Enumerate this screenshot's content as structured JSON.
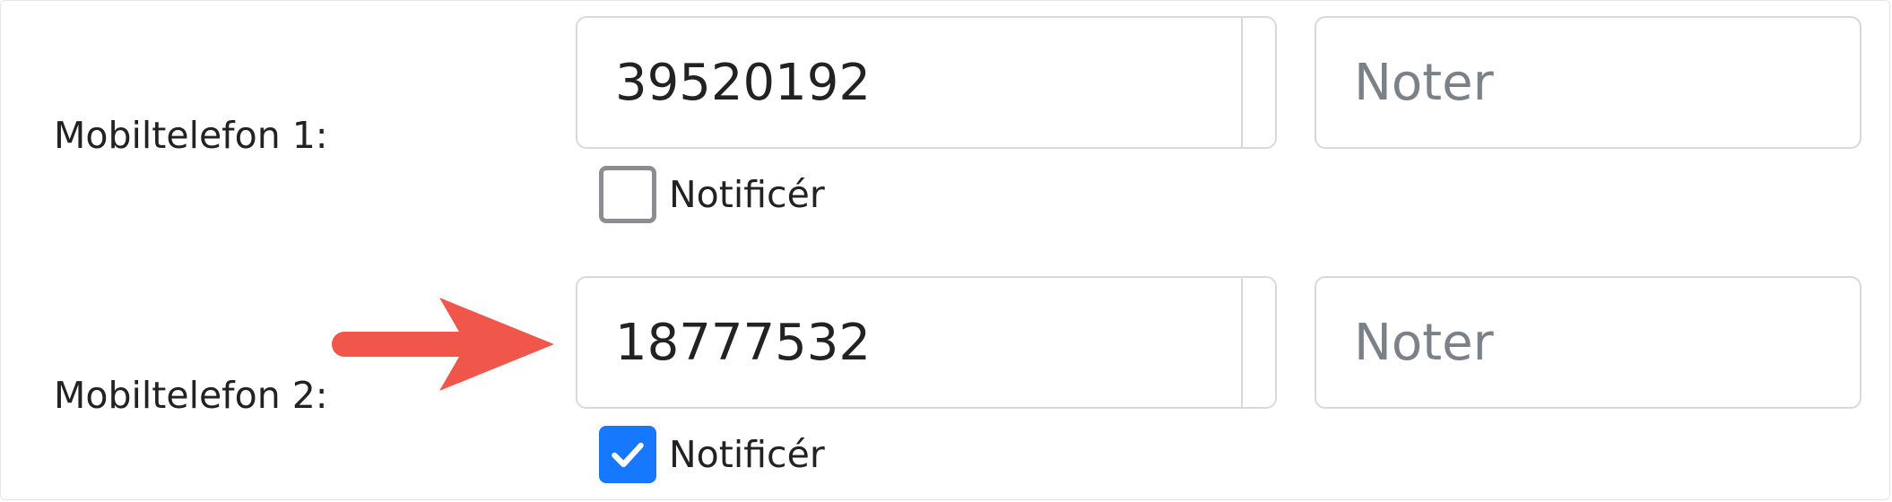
{
  "fields": [
    {
      "label": "Mobiltelefon 1:",
      "phone_value": "39520192",
      "notes_placeholder": "Noter",
      "notify_label": "Notificér",
      "notify_checked": false
    },
    {
      "label": "Mobiltelefon 2:",
      "phone_value": "18777532",
      "notes_placeholder": "Noter",
      "notify_label": "Notificér",
      "notify_checked": true
    }
  ],
  "icons": {
    "sms": "speech-bubble-icon",
    "call": "phone-icon",
    "check": "checkmark-icon",
    "annotation": "arrow-right-icon"
  },
  "colors": {
    "checkbox_checked": "#1677ff",
    "checkbox_unchecked_border": "#8c8c92",
    "arrow": "#f0564a",
    "border": "#d9d9d9",
    "placeholder": "#7b8188"
  }
}
